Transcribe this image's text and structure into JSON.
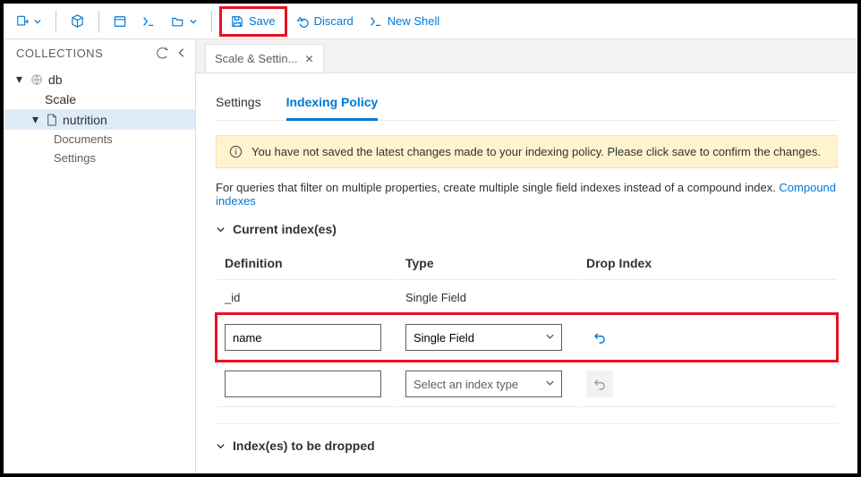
{
  "toolbar": {
    "save_label": "Save",
    "discard_label": "Discard",
    "new_shell_label": "New Shell"
  },
  "sidebar": {
    "title": "COLLECTIONS",
    "db": "db",
    "scale": "Scale",
    "collection": "nutrition",
    "leaf_documents": "Documents",
    "leaf_settings": "Settings"
  },
  "tab": {
    "label": "Scale & Settin..."
  },
  "subtabs": {
    "settings": "Settings",
    "indexing": "Indexing Policy"
  },
  "banner": {
    "text": "You have not saved the latest changes made to your indexing policy. Please click save to confirm the changes."
  },
  "hint": {
    "text": "For queries that filter on multiple properties, create multiple single field indexes instead of a compound index. ",
    "link": "Compound indexes"
  },
  "sections": {
    "current": "Current index(es)",
    "dropped": "Index(es) to be dropped"
  },
  "table": {
    "col_def": "Definition",
    "col_type": "Type",
    "col_drop": "Drop Index",
    "rows": [
      {
        "def": "_id",
        "type": "Single Field",
        "editable": false
      },
      {
        "def": "name",
        "type": "Single Field",
        "editable": true,
        "highlight": true
      },
      {
        "def": "",
        "type_placeholder": "Select an index type",
        "editable": true,
        "new": true
      }
    ]
  }
}
